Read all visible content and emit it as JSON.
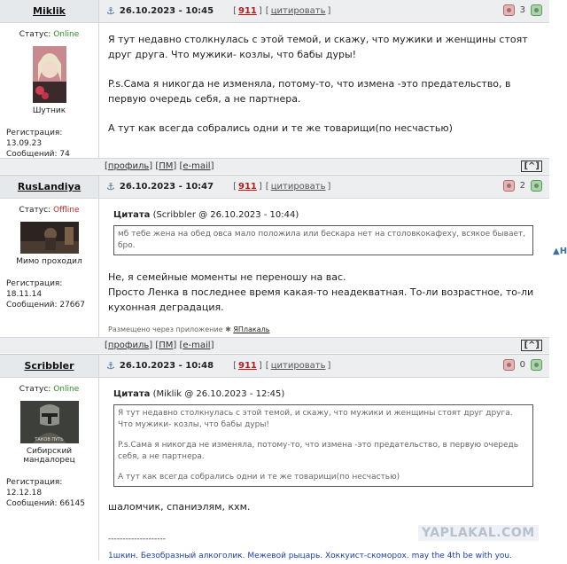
{
  "posts": [
    {
      "author": "Miklik",
      "status_label": "Статус:",
      "status": "Online",
      "rank": "Шутник",
      "reg_label": "Регистрация:",
      "reg_date": "13.09.23",
      "msgs_label": "Сообщений:",
      "msgs": "74",
      "date": "26.10.2023 - 10:45",
      "number": "911",
      "cite": "цитировать",
      "rating": "3",
      "paragraphs": [
        "Я тут недавно столкнулась с этой темой, и скажу, что мужики и женщины стоят друг друга. Что мужики- козлы, что бабы дуры!",
        "P.s.Сама я никогда не изменяла, потому-то, что измена -это предательство, в первую очередь себя, а не партнера.",
        "А тут как всегда собрались одни и те же товарищи(по несчастью)"
      ]
    },
    {
      "author": "RusLandiya",
      "status_label": "Статус:",
      "status": "Offline",
      "rank": "Мимо проходил",
      "reg_label": "Регистрация:",
      "reg_date": "18.11.14",
      "msgs_label": "Сообщений:",
      "msgs": "27667",
      "date": "26.10.2023 - 10:47",
      "number": "911",
      "cite": "цитировать",
      "rating": "2",
      "quote_title": "Цитата",
      "quote_src": "(Scribbler @ 26.10.2023 - 10:44)",
      "quote_text": "мб тебе жена на обед овса мало положила или бескара нет на столовкокафеху, всякое бывает, бро.",
      "paragraphs": [
        "Не, я семейные моменты не переношу на вас.",
        "Просто Ленка в последнее время какая-то неадекватная. То-ли возрастное, то-ли кухонная деградация."
      ],
      "via_text": "Размещено через приложение",
      "via_app": "ЯПлакаль"
    },
    {
      "author": "Scribbler",
      "status_label": "Статус:",
      "status": "Online",
      "rank": "Сибирский мандалорец",
      "reg_label": "Регистрация:",
      "reg_date": "12.12.18",
      "msgs_label": "Сообщений:",
      "msgs": "66145",
      "date": "26.10.2023 - 10:48",
      "number": "911",
      "cite": "цитировать",
      "rating": "0",
      "quote_title": "Цитата",
      "quote_src": "(Miklik @ 26.10.2023 - 12:45)",
      "quote_paragraphs": [
        "Я тут недавно столкнулась с этой темой, и скажу, что мужики и женщины стоят друг друга. Что мужики- козлы, что бабы дуры!",
        "P.s.Сама я никогда не изменяла, потому-то, что измена -это предательство, в первую очередь себя, а не партнера.",
        "А тут как всегда собрались одни и те же товарищи(по несчастью)"
      ],
      "text": "шаломчик, спаниэлям, кхм.",
      "sig_sep": "--------------------",
      "signature": "1шкин. Безобразный алкоголик. Межевой рыцарь. Хоккуист-скоморох. may the 4th be with you."
    }
  ],
  "footer": {
    "profile": "профиль",
    "pm": "ПМ",
    "email": "e-mail",
    "top": "[^]"
  },
  "edge_arrow": "▲H",
  "watermark": "YAPLAKAL.COM",
  "avatar2_caption": "",
  "avatar3_caption": "ТАКОВ ПУТЬ",
  "colors": {
    "online": "#2e8b2e",
    "offline": "#c62828",
    "number": "#b71c1c",
    "signature": "#1a3fa8"
  }
}
